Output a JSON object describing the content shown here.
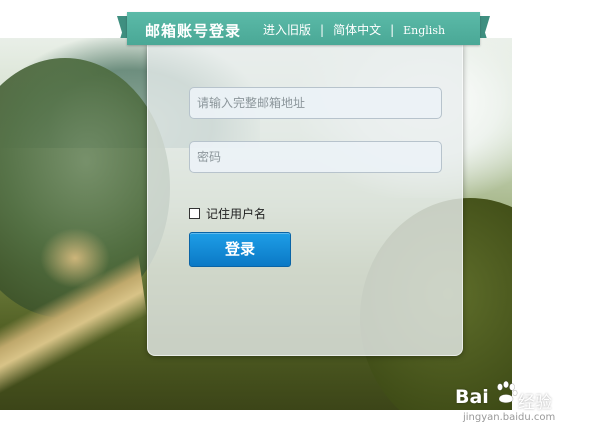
{
  "header": {
    "title": "邮箱账号登录",
    "links": [
      {
        "label": "进入旧版"
      },
      {
        "label": "简体中文"
      },
      {
        "label": "English"
      }
    ],
    "separator": "|",
    "color": "#4aa896"
  },
  "form": {
    "email_placeholder": "请输入完整邮箱地址",
    "password_placeholder": "密码",
    "remember_label": "记住用户名",
    "submit_label": "登录",
    "button_color": "#0b79c6"
  },
  "watermark": {
    "brand_prefix": "Bai",
    "brand_suffix": "经验",
    "url": "jingyan.baidu.com",
    "paw_icon": "baidu-paw-icon"
  }
}
